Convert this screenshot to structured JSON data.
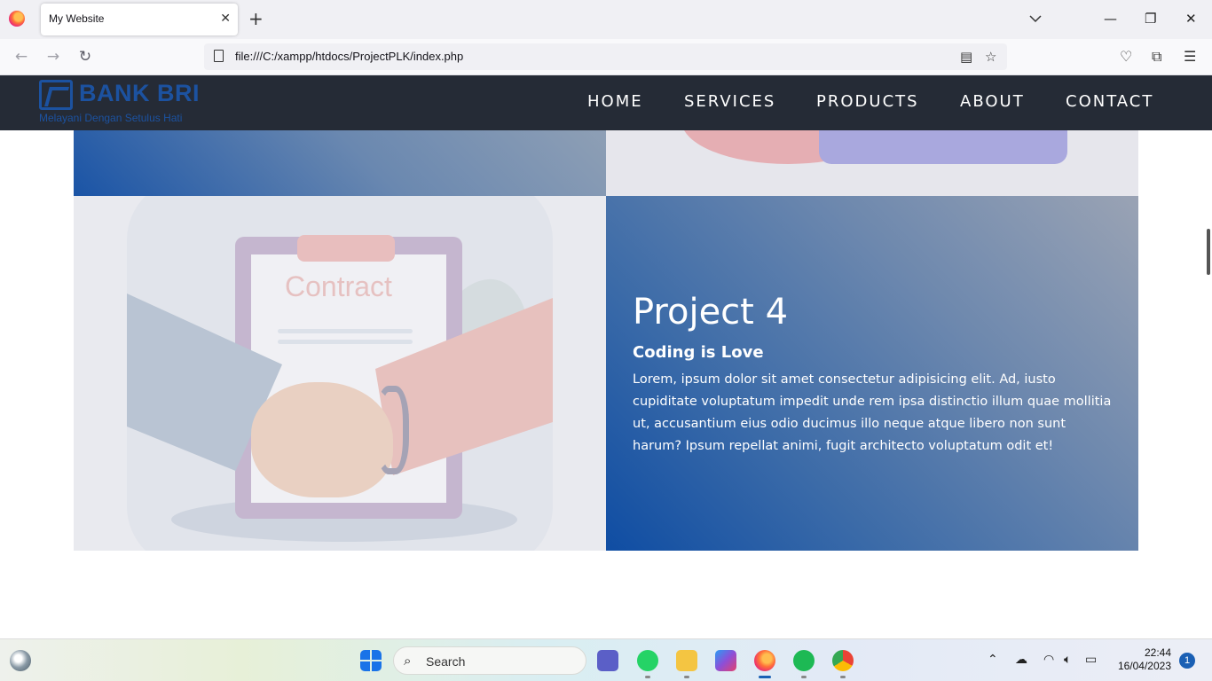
{
  "browser": {
    "tab_title": "My Website",
    "tab_close": "✕",
    "new_tab": "+",
    "url": "file:///C:/xampp/htdocs/ProjectPLK/index.php",
    "window_controls": {
      "minimize": "—",
      "restore": "❐",
      "close": "✕"
    }
  },
  "site": {
    "logo_text": "BANK BRI",
    "logo_tagline": "Melayani Dengan Setulus Hati",
    "menu": [
      "HOME",
      "SERVICES",
      "PRODUCTS",
      "ABOUT",
      "CONTACT"
    ],
    "contract_image_text": "Contract",
    "project": {
      "title": "Project 4",
      "subtitle": "Coding is Love",
      "body": "Lorem, ipsum dolor sit amet consectetur adipisicing elit. Ad, iusto cupiditate voluptatum impedit unde rem ipsa distinctio illum quae mollitia ut, accusantium eius odio ducimus illo neque atque libero non sunt harum? Ipsum repellat animi, fugit architecto voluptatum odit et!"
    }
  },
  "taskbar": {
    "search_placeholder": "Search",
    "time": "22:44",
    "date": "16/04/2023",
    "notification_count": "1"
  },
  "colors": {
    "header_bg": "#252b36",
    "brand_blue": "#1c52a0",
    "panel_gradient_start": "#0f4da3",
    "panel_gradient_end": "#9aa3b4"
  }
}
